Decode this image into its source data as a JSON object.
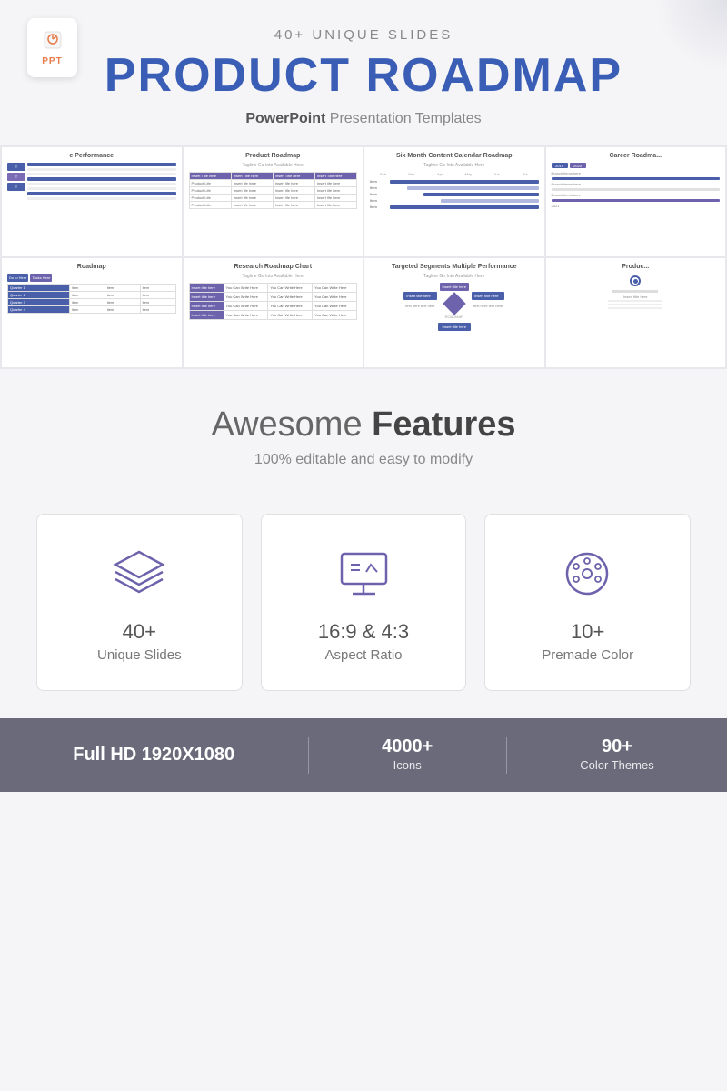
{
  "header": {
    "badge_text": "PPT",
    "subtitle_top": "40+ UNIQUE SLIDES",
    "title_plain": "PRODUCT ",
    "title_bold": "ROADMAP",
    "description_plain": "PowerPoint ",
    "description_bold_end": "Presentation Templates"
  },
  "slides": {
    "row1": [
      {
        "title": "e Performance",
        "subtitle": "",
        "type": "performance"
      },
      {
        "title": "Product Roadmap",
        "subtitle": "Tagline Go Into Available Here",
        "type": "roadmap_table"
      },
      {
        "title": "Six Month Content Calendar Roadmap",
        "subtitle": "Tagline Go Into Available Here",
        "type": "gantt"
      },
      {
        "title": "Career Roadma...",
        "subtitle": "",
        "type": "career"
      }
    ],
    "row2": [
      {
        "title": "Roadmap",
        "subtitle": "",
        "type": "roadmap2"
      },
      {
        "title": "Research Roadmap Chart",
        "subtitle": "Tagline Go Into Available Here",
        "type": "research"
      },
      {
        "title": "Targeted Segments Multiple Performance",
        "subtitle": "Tagline Go Into Available Here",
        "type": "segments"
      },
      {
        "title": "Produc...",
        "subtitle": "",
        "type": "product2"
      }
    ]
  },
  "features": {
    "title_plain": "Awesome ",
    "title_bold": "Features",
    "subtitle": "100% editable and easy to modify"
  },
  "feature_cards": [
    {
      "icon": "layers",
      "number": "40+",
      "label": "Unique Slides"
    },
    {
      "icon": "monitor",
      "number": "16:9 & 4:3",
      "label": "Aspect Ratio"
    },
    {
      "icon": "palette",
      "number": "10+",
      "label": "Premade Color"
    }
  ],
  "footer": [
    {
      "value": "Full HD 1920X1080",
      "label": ""
    },
    {
      "value": "4000+",
      "label": "Icons"
    },
    {
      "value": "90+",
      "label": "Color Themes"
    }
  ]
}
